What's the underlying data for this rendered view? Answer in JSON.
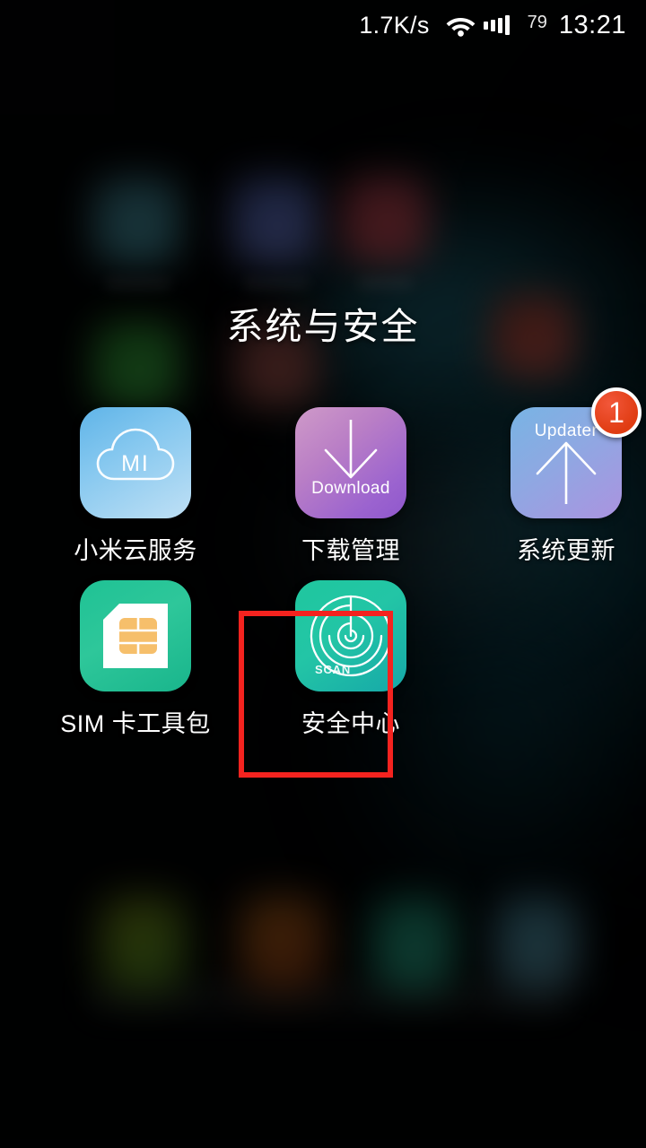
{
  "status_bar": {
    "network_speed": "1.7K/s",
    "wifi_icon": "wifi-icon",
    "signal_icon": "signal-bars-icon",
    "battery_level": "79",
    "clock": "13:21"
  },
  "folder": {
    "title": "系统与安全",
    "rows": [
      [
        {
          "label": "小米云服务",
          "icon_name": "mi-cloud-icon",
          "icon_text": "MI",
          "badge": null
        },
        {
          "label": "下载管理",
          "icon_name": "download-icon",
          "icon_text": "Download",
          "badge": null
        },
        {
          "label": "系统更新",
          "icon_name": "system-update-icon",
          "icon_text": "Updater",
          "badge": "1"
        }
      ],
      [
        {
          "label": "SIM 卡工具包",
          "icon_name": "sim-toolkit-icon",
          "icon_text": "",
          "badge": null
        },
        {
          "label": "安全中心",
          "icon_name": "security-center-scan-icon",
          "icon_text": "SCAN",
          "badge": null
        },
        {
          "label": "",
          "icon_name": "",
          "icon_text": "",
          "badge": null
        }
      ]
    ]
  },
  "annotation": {
    "highlight_target": "安全中心",
    "highlight_color": "#f4231f"
  },
  "colors": {
    "badge_red": "#e03c12",
    "highlight_red": "#f4231f",
    "text_white": "#ffffff",
    "background_black": "#020304"
  }
}
